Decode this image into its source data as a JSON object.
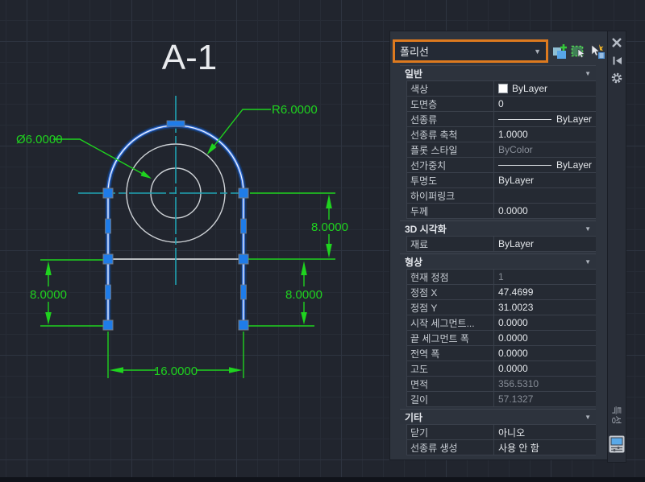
{
  "canvas": {
    "title": "A-1",
    "labels": {
      "radius": "R6.0000",
      "diameter": "Ø6.0000",
      "dim_right_upper": "8.0000",
      "dim_left": "8.0000",
      "dim_right_lower": "8.0000",
      "dim_bottom": "16.0000"
    },
    "colors": {
      "dimension_green": "#1fd31f",
      "centerline_cyan": "#21a3b3",
      "selection_blue": "#2f6bd8",
      "grip_blue": "#1f7ce8",
      "geometry_white": "#ced2d6"
    }
  },
  "palette": {
    "selector": {
      "value": "폴리선",
      "highlight_color": "#dd7a1f"
    },
    "toolbar": {
      "pickadd": "toggle-pickadd",
      "select_objects": "select-objects",
      "quick_select": "quick-select"
    },
    "titlebar": {
      "close": "close",
      "autohide": "auto-hide",
      "settings": "settings",
      "tab_label": "특성"
    },
    "sections": [
      {
        "title": "일반",
        "rows": [
          {
            "label": "색상",
            "value": "ByLayer"
          },
          {
            "label": "도면층",
            "value": "0"
          },
          {
            "label": "선종류",
            "value": "ByLayer"
          },
          {
            "label": "선종류 축척",
            "value": "1.0000"
          },
          {
            "label": "플롯 스타일",
            "value": "ByColor"
          },
          {
            "label": "선가중치",
            "value": "ByLayer"
          },
          {
            "label": "투명도",
            "value": "ByLayer"
          },
          {
            "label": "하이퍼링크",
            "value": ""
          },
          {
            "label": "두께",
            "value": "0.0000"
          }
        ]
      },
      {
        "title": "3D 시각화",
        "rows": [
          {
            "label": "재료",
            "value": "ByLayer"
          }
        ]
      },
      {
        "title": "형상",
        "rows": [
          {
            "label": "현재 정점",
            "value": "1"
          },
          {
            "label": "정점 X",
            "value": "47.4699"
          },
          {
            "label": "정점 Y",
            "value": "31.0023"
          },
          {
            "label": "시작 세그먼트...",
            "value": "0.0000"
          },
          {
            "label": "끝 세그먼트 폭",
            "value": "0.0000"
          },
          {
            "label": "전역 폭",
            "value": "0.0000"
          },
          {
            "label": "고도",
            "value": "0.0000"
          },
          {
            "label": "면적",
            "value": "356.5310"
          },
          {
            "label": "길이",
            "value": "57.1327"
          }
        ]
      },
      {
        "title": "기타",
        "rows": [
          {
            "label": "닫기",
            "value": "아니오"
          },
          {
            "label": "선종류 생성",
            "value": "사용 안 함"
          }
        ]
      }
    ]
  }
}
